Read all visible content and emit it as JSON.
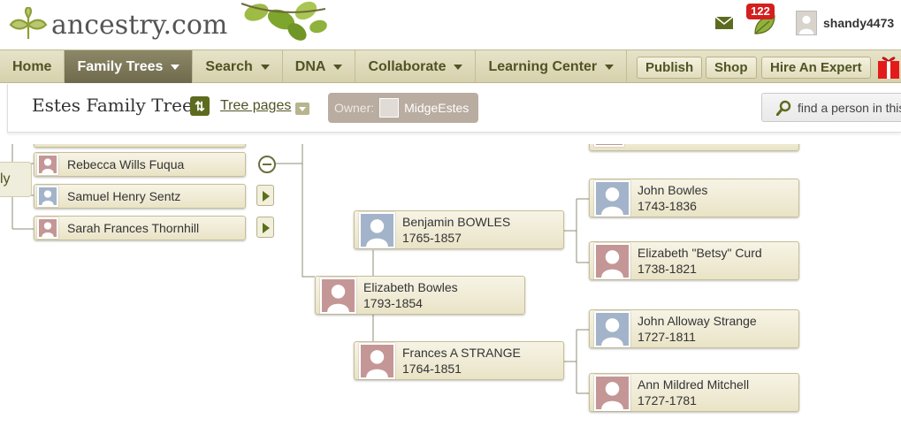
{
  "header": {
    "logo_text": "ancestry.com",
    "notifications_count": "122",
    "username": "shandy4473"
  },
  "nav": {
    "items": [
      {
        "label": "Home"
      },
      {
        "label": "Family Trees"
      },
      {
        "label": "Search"
      },
      {
        "label": "DNA"
      },
      {
        "label": "Collaborate"
      },
      {
        "label": "Learning Center"
      }
    ],
    "buttons": {
      "publish": "Publish",
      "shop": "Shop",
      "hire_expert": "Hire An Expert"
    }
  },
  "toolbar": {
    "tree_title": "Estes Family Tree",
    "tree_pages": "Tree pages",
    "owner_label": "Owner:",
    "owner_name": "MidgeEstes",
    "find_placeholder": "find a person in this tree"
  },
  "tree": {
    "side_tab_label": "ly",
    "left_people": [
      {
        "name": "Rebecca Wills Fuqua",
        "gender": "f"
      },
      {
        "name": "Samuel Henry Sentz",
        "gender": "m"
      },
      {
        "name": "Sarah Frances Thornhill",
        "gender": "f"
      }
    ],
    "focus": {
      "name": "Elizabeth Bowles",
      "years": "1793-1854",
      "gender": "f"
    },
    "parents": [
      {
        "name": "Benjamin BOWLES",
        "years": "1765-1857",
        "gender": "m"
      },
      {
        "name": "Frances A STRANGE",
        "years": "1764-1851",
        "gender": "f"
      }
    ],
    "grandparents": [
      {
        "name": "John Bowles",
        "years": "1743-1836",
        "gender": "m"
      },
      {
        "name": "Elizabeth \"Betsy\" Curd",
        "years": "1738-1821",
        "gender": "f"
      },
      {
        "name": "John Alloway Strange",
        "years": "1727-1811",
        "gender": "m"
      },
      {
        "name": "Ann Mildred Mitchell",
        "years": "1727-1781",
        "gender": "f"
      }
    ]
  },
  "colors": {
    "nav_text": "#4f5325",
    "female_portrait": "#c59696",
    "male_portrait": "#a3b3c9",
    "badge": "#d41f1f"
  }
}
